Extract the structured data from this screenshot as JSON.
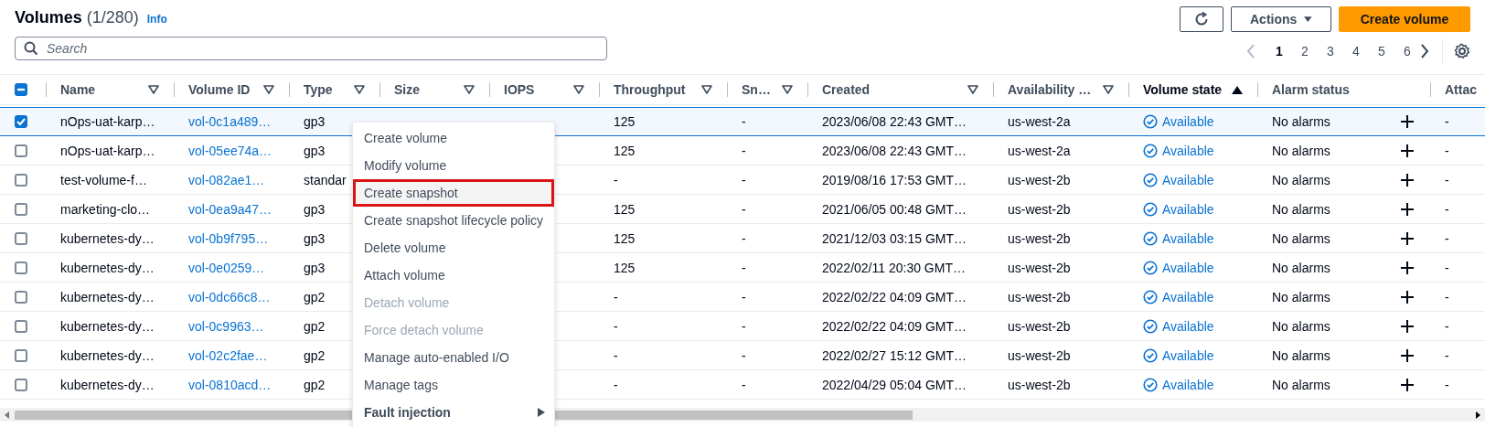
{
  "header": {
    "title": "Volumes",
    "count": "(1/280)",
    "info_link": "Info"
  },
  "toolbar": {
    "actions_button": "Actions",
    "create_button": "Create volume"
  },
  "search": {
    "placeholder": "Search"
  },
  "pagination": {
    "pages": [
      {
        "label": "1",
        "selected": true
      },
      {
        "label": "2",
        "selected": false
      },
      {
        "label": "3",
        "selected": false
      },
      {
        "label": "4",
        "selected": false
      },
      {
        "label": "5",
        "selected": false
      },
      {
        "label": "6",
        "selected": false
      }
    ],
    "previous_disabled": true
  },
  "table": {
    "select_all_indeterminate": true,
    "columns": [
      {
        "label": "Name",
        "sortable": true,
        "sorted": false
      },
      {
        "label": "Volume ID",
        "sortable": true,
        "sorted": false
      },
      {
        "label": "Type",
        "sortable": true,
        "sorted": false
      },
      {
        "label": "Size",
        "sortable": true,
        "sorted": false
      },
      {
        "label": "IOPS",
        "sortable": true,
        "sorted": false
      },
      {
        "label": "Throughput",
        "sortable": true,
        "sorted": false
      },
      {
        "label": "Sn…",
        "sortable": true,
        "sorted": false
      },
      {
        "label": "Created",
        "sortable": true,
        "sorted": false
      },
      {
        "label": "Availability …",
        "sortable": true,
        "sorted": false
      },
      {
        "label": "Volume state",
        "sortable": true,
        "sorted": true
      },
      {
        "label": "Alarm status",
        "sortable": false,
        "sorted": false
      },
      {
        "label": "Attac"
      }
    ],
    "rows": [
      {
        "selected": true,
        "name": "nOps-uat-karp…",
        "volume_id": "vol-0c1a489…",
        "type": "gp3",
        "throughput": "125",
        "snapshot": "-",
        "created": "2023/06/08 22:43 GMT…",
        "zone": "us-west-2a",
        "state": "Available",
        "alarm": "No alarms",
        "attached": "-"
      },
      {
        "selected": false,
        "name": "nOps-uat-karp…",
        "volume_id": "vol-05ee74a…",
        "type": "gp3",
        "throughput": "125",
        "snapshot": "-",
        "created": "2023/06/08 22:43 GMT…",
        "zone": "us-west-2a",
        "state": "Available",
        "alarm": "No alarms",
        "attached": "-"
      },
      {
        "selected": false,
        "name": "test-volume-f…",
        "volume_id": "vol-082ae1…",
        "type": "standar",
        "throughput": "-",
        "snapshot": "-",
        "created": "2019/08/16 17:53 GMT…",
        "zone": "us-west-2b",
        "state": "Available",
        "alarm": "No alarms",
        "attached": "-"
      },
      {
        "selected": false,
        "name": "marketing-clo…",
        "volume_id": "vol-0ea9a47…",
        "type": "gp3",
        "throughput": "125",
        "snapshot": "-",
        "created": "2021/06/05 00:48 GMT…",
        "zone": "us-west-2b",
        "state": "Available",
        "alarm": "No alarms",
        "attached": "-"
      },
      {
        "selected": false,
        "name": "kubernetes-dy…",
        "volume_id": "vol-0b9f795…",
        "type": "gp3",
        "throughput": "125",
        "snapshot": "-",
        "created": "2021/12/03 03:15 GMT…",
        "zone": "us-west-2b",
        "state": "Available",
        "alarm": "No alarms",
        "attached": "-"
      },
      {
        "selected": false,
        "name": "kubernetes-dy…",
        "volume_id": "vol-0e0259…",
        "type": "gp3",
        "throughput": "125",
        "snapshot": "-",
        "created": "2022/02/11 20:30 GMT…",
        "zone": "us-west-2b",
        "state": "Available",
        "alarm": "No alarms",
        "attached": "-"
      },
      {
        "selected": false,
        "name": "kubernetes-dy…",
        "volume_id": "vol-0dc66c8…",
        "type": "gp2",
        "throughput": "-",
        "snapshot": "-",
        "created": "2022/02/22 04:09 GMT…",
        "zone": "us-west-2b",
        "state": "Available",
        "alarm": "No alarms",
        "attached": "-"
      },
      {
        "selected": false,
        "name": "kubernetes-dy…",
        "volume_id": "vol-0c9963…",
        "type": "gp2",
        "throughput": "-",
        "snapshot": "-",
        "created": "2022/02/22 04:09 GMT…",
        "zone": "us-west-2b",
        "state": "Available",
        "alarm": "No alarms",
        "attached": "-"
      },
      {
        "selected": false,
        "name": "kubernetes-dy…",
        "volume_id": "vol-02c2fae…",
        "type": "gp2",
        "throughput": "-",
        "snapshot": "-",
        "created": "2022/02/27 15:12 GMT…",
        "zone": "us-west-2b",
        "state": "Available",
        "alarm": "No alarms",
        "attached": "-"
      },
      {
        "selected": false,
        "name": "kubernetes-dy…",
        "volume_id": "vol-0810acd…",
        "type": "gp2",
        "throughput": "-",
        "snapshot": "-",
        "created": "2022/04/29 05:04 GMT…",
        "zone": "us-west-2b",
        "state": "Available",
        "alarm": "No alarms",
        "attached": "-"
      }
    ]
  },
  "context_menu": {
    "items": [
      {
        "label": "Create volume",
        "kind": "action",
        "disabled": false,
        "selected": false
      },
      {
        "label": "Modify volume",
        "kind": "action",
        "disabled": false,
        "selected": false
      },
      {
        "label": "Create snapshot",
        "kind": "action",
        "disabled": false,
        "selected": true
      },
      {
        "label": "Create snapshot lifecycle policy",
        "kind": "action",
        "disabled": false,
        "selected": false
      },
      {
        "label": "Delete volume",
        "kind": "action",
        "disabled": false,
        "selected": false
      },
      {
        "label": "Attach volume",
        "kind": "action",
        "disabled": false,
        "selected": false
      },
      {
        "label": "Detach volume",
        "kind": "action",
        "disabled": true,
        "selected": false
      },
      {
        "label": "Force detach volume",
        "kind": "action",
        "disabled": true,
        "selected": false
      },
      {
        "label": "Manage auto-enabled I/O",
        "kind": "action",
        "disabled": false,
        "selected": false
      },
      {
        "label": "Manage tags",
        "kind": "action",
        "disabled": false,
        "selected": false
      },
      {
        "label": "Fault injection",
        "kind": "submenu",
        "disabled": false,
        "selected": false
      }
    ]
  }
}
